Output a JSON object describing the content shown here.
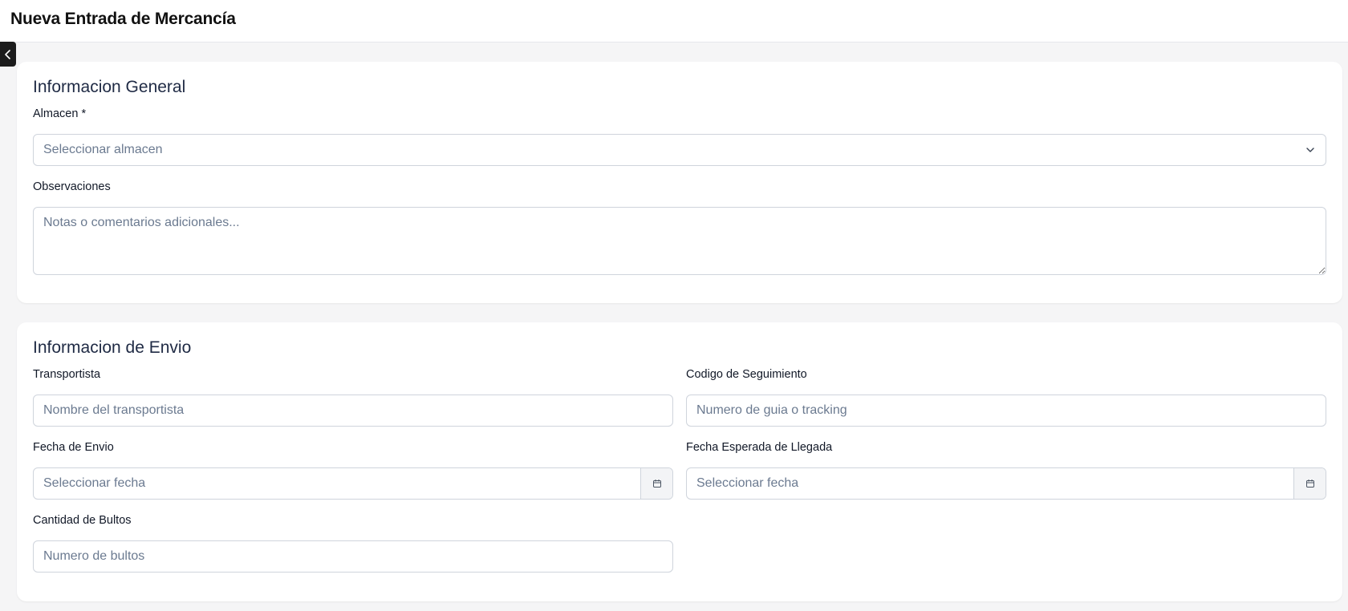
{
  "header": {
    "title": "Nueva Entrada de Mercancía"
  },
  "general": {
    "title": "Informacion General",
    "warehouse_label": "Almacen *",
    "warehouse_placeholder": "Seleccionar almacen",
    "notes_label": "Observaciones",
    "notes_placeholder": "Notas o comentarios adicionales..."
  },
  "shipping": {
    "title": "Informacion de Envio",
    "carrier_label": "Transportista",
    "carrier_placeholder": "Nombre del transportista",
    "tracking_label": "Codigo de Seguimiento",
    "tracking_placeholder": "Numero de guia o tracking",
    "ship_date_label": "Fecha de Envio",
    "ship_date_placeholder": "Seleccionar fecha",
    "eta_label": "Fecha Esperada de Llegada",
    "eta_placeholder": "Seleccionar fecha",
    "packages_label": "Cantidad de Bultos",
    "packages_placeholder": "Numero de bultos"
  },
  "icons": {
    "collapse": "chevron-left-icon",
    "select": "chevron-down-icon",
    "date": "calendar-icon"
  }
}
